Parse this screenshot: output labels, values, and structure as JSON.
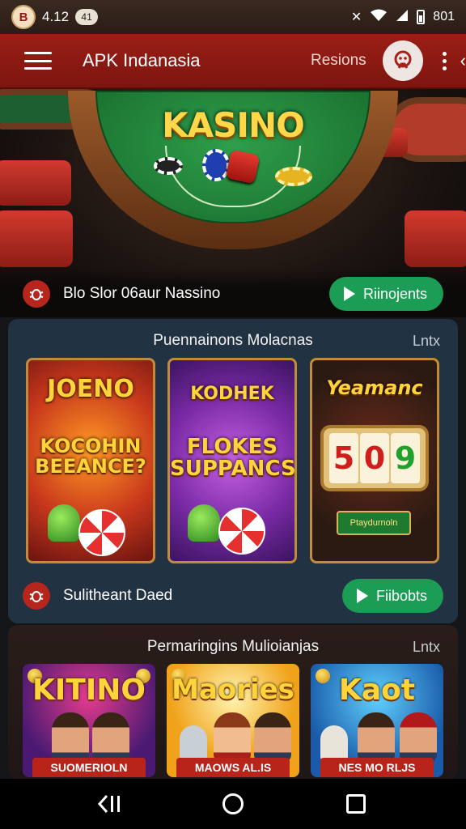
{
  "status_bar": {
    "app_badge": "B",
    "time": "4.12",
    "notification": "41",
    "icons": [
      "x-icon",
      "wifi-icon",
      "signal-icon",
      "battery-icon"
    ],
    "network": "801"
  },
  "app_bar": {
    "title": "APK Indanasia",
    "action_label": "Resions",
    "icons": [
      "menu-icon",
      "avatar-icon",
      "more-vert-icon",
      "chevron-left-icon"
    ]
  },
  "hero": {
    "title": "KASINO",
    "caption": "Blo Slor 06aur Nassino",
    "button_label": "Riinojents"
  },
  "section_1": {
    "title": "Puennainons Molacnas",
    "link": "Lntx",
    "cards": [
      {
        "top": "JOENO",
        "bottom": "KOCOHIN BEEANCE?"
      },
      {
        "top": "KODHEK",
        "bottom": "FLOKES SUPPANCS"
      },
      {
        "top": "Yeamanc",
        "reels": [
          "5",
          "0",
          "9"
        ],
        "banner": "Ptaydurnoln"
      }
    ],
    "footer_caption": "Sulitheant Daed",
    "footer_button": "Fiibobts"
  },
  "section_2": {
    "title": "Permaringins Mulioianjas",
    "link": "Lntx",
    "cards": [
      {
        "title": "KITINO",
        "label": "SUOMERIOLN"
      },
      {
        "title": "Maories",
        "label": "MAOWS AL.IS"
      },
      {
        "title": "Kaot",
        "label": "NES MO RLJS"
      }
    ]
  },
  "colors": {
    "brand_red": "#8b1a12",
    "action_green": "#1c9d55",
    "panel_blue": "#213243",
    "gold": "#ffd43a"
  }
}
